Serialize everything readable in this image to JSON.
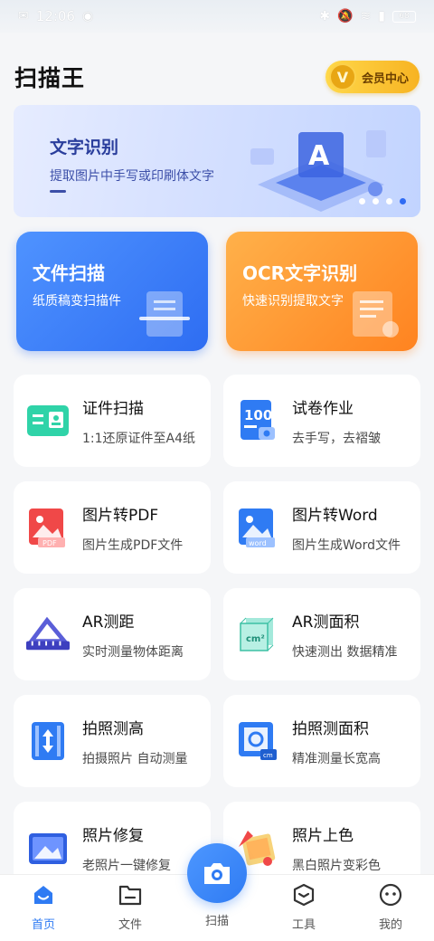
{
  "status_bar": {
    "time": "12:06",
    "battery": "68"
  },
  "header": {
    "title": "扫描王",
    "vip_label": "会员中心"
  },
  "banner": {
    "title": "文字识别",
    "subtitle": "提取图片中手写或印刷体文字",
    "page_count": 4,
    "active_page": 4
  },
  "feature_cards": [
    {
      "title": "文件扫描",
      "subtitle": "纸质稿变扫描件",
      "color": "#2e6df2"
    },
    {
      "title": "OCR文字识别",
      "subtitle": "快速识别提取文字",
      "color": "#ff8320"
    }
  ],
  "tools": [
    {
      "title": "证件扫描",
      "subtitle": "1:1还原证件至A4纸",
      "icon": "id-card-icon"
    },
    {
      "title": "试卷作业",
      "subtitle": "去手写，去褶皱",
      "icon": "exam-paper-icon"
    },
    {
      "title": "图片转PDF",
      "subtitle": "图片生成PDF文件",
      "icon": "image-pdf-icon"
    },
    {
      "title": "图片转Word",
      "subtitle": "图片生成Word文件",
      "icon": "image-word-icon"
    },
    {
      "title": "AR测距",
      "subtitle": "实时测量物体距离",
      "icon": "ruler-icon"
    },
    {
      "title": "AR测面积",
      "subtitle": "快速测出 数据精准",
      "icon": "cube-area-icon"
    },
    {
      "title": "拍照测高",
      "subtitle": "拍摄照片 自动测量",
      "icon": "height-measure-icon"
    },
    {
      "title": "拍照测面积",
      "subtitle": "精准测量长宽高",
      "icon": "photo-area-icon"
    },
    {
      "title": "照片修复",
      "subtitle": "老照片一键修复",
      "icon": "photo-restore-icon"
    },
    {
      "title": "照片上色",
      "subtitle": "黑白照片变彩色",
      "icon": "photo-colorize-icon"
    }
  ],
  "tabbar": {
    "home": "首页",
    "files": "文件",
    "scan": "扫描",
    "tools": "工具",
    "mine": "我的"
  }
}
